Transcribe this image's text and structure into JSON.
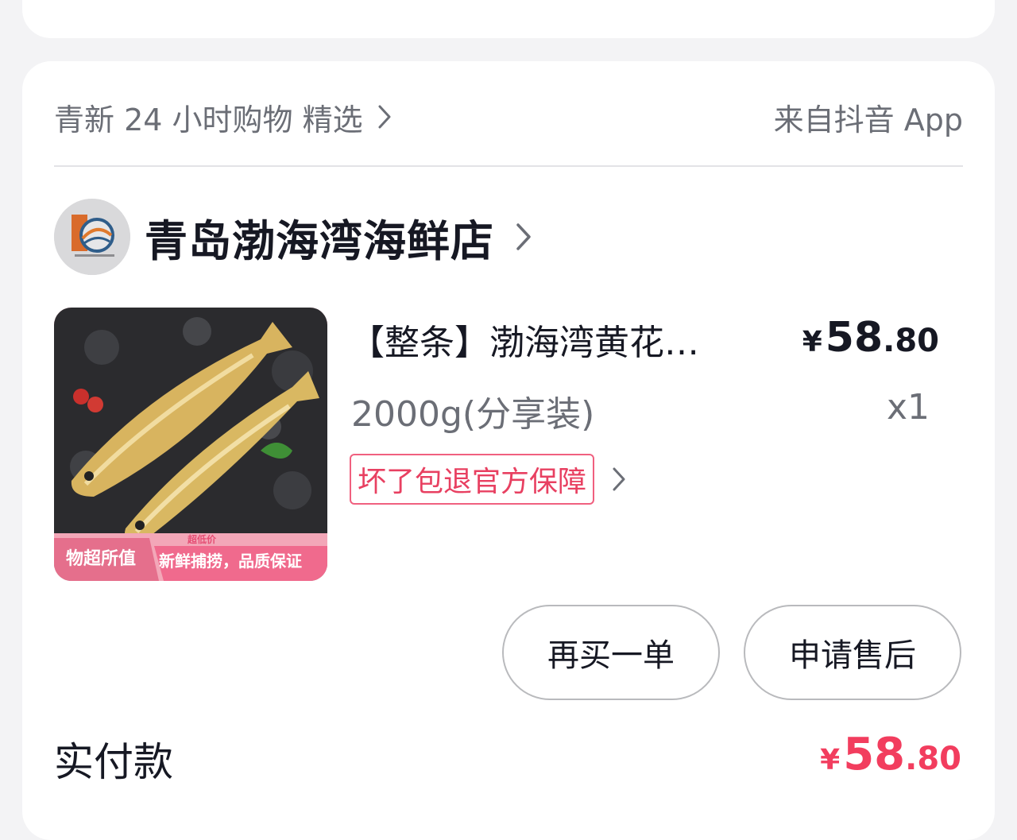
{
  "colors": {
    "accent": "#f23d5e",
    "guarantee": "#e84061",
    "muted": "#6b6e76",
    "text": "#161823"
  },
  "order": {
    "source_label": "青新 24 小时购物 精选",
    "source_app": "来自抖音 App",
    "shop_name": "青岛渤海湾海鲜店",
    "product": {
      "title": "【整条】渤海湾黄花…",
      "spec": "2000g(分享装)",
      "price_symbol": "¥",
      "price_int": "58",
      "price_dec": ".80",
      "quantity": "x1",
      "guarantee": "坏了包退官方保障",
      "image_labels": {
        "left": "物超所值",
        "top": "超低价",
        "right": "新鲜捕捞，品质保证"
      }
    },
    "buttons": {
      "rebuy": "再买一单",
      "aftersale": "申请售后"
    },
    "paid": {
      "label": "实付款",
      "symbol": "¥",
      "int": "58",
      "dec": ".80"
    }
  },
  "icons": {
    "chevron": "chevron-right-icon",
    "shop_logo": "shop-logo-icon"
  }
}
